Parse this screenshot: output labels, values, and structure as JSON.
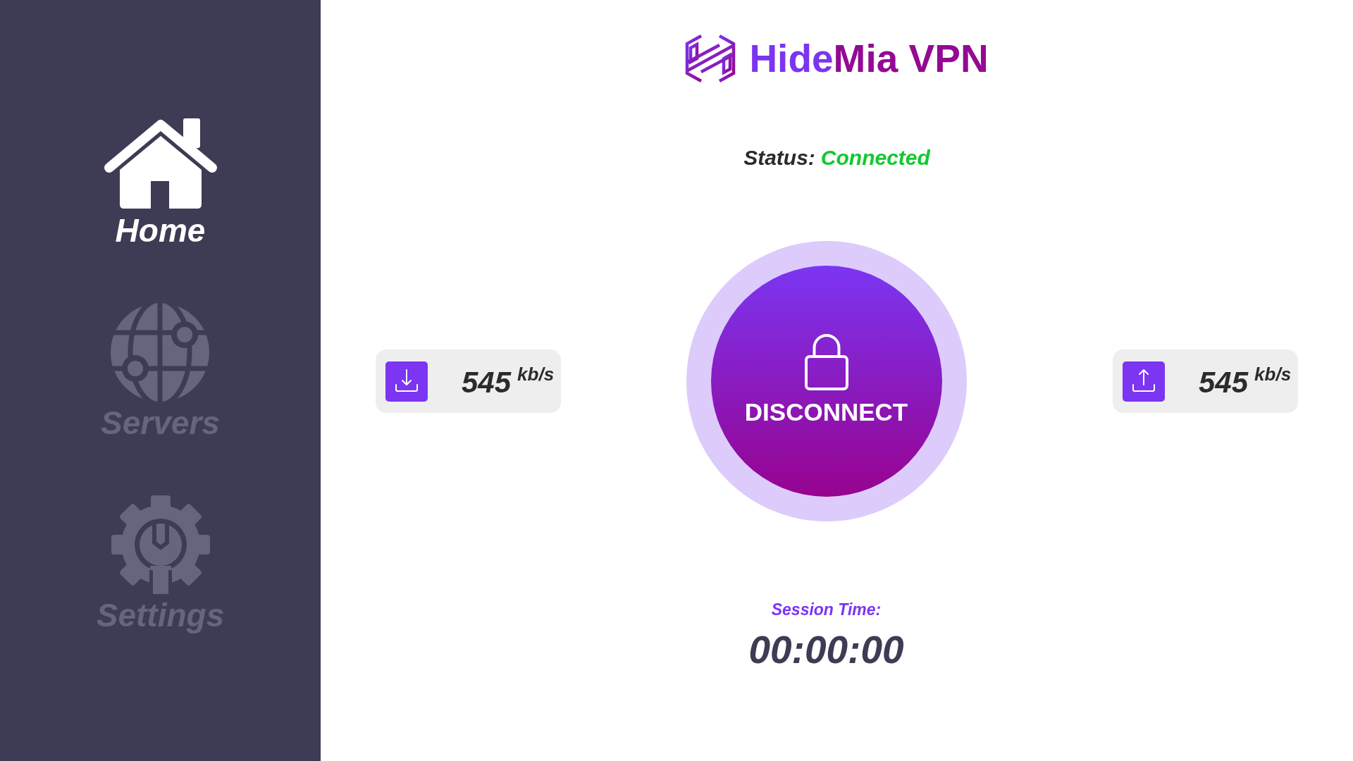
{
  "sidebar": {
    "items": [
      {
        "kind": "home",
        "label": "Home",
        "selected": true
      },
      {
        "kind": "servers",
        "label": "Servers",
        "selected": false
      },
      {
        "kind": "settings",
        "label": "Settings",
        "selected": false
      }
    ]
  },
  "logo": {
    "text_parts": [
      "Hide",
      "Mia VPN"
    ]
  },
  "status": {
    "label": "Status:",
    "value": "Connected",
    "connected": true
  },
  "speeds": [
    {
      "kind": "download",
      "value": "545",
      "unit": "kb/s"
    },
    {
      "kind": "upload",
      "value": "545",
      "unit": "kb/s"
    }
  ],
  "power_button": {
    "label": "DISCONNECT"
  },
  "session": {
    "label": "Session Time:",
    "time": "00:00:00"
  }
}
